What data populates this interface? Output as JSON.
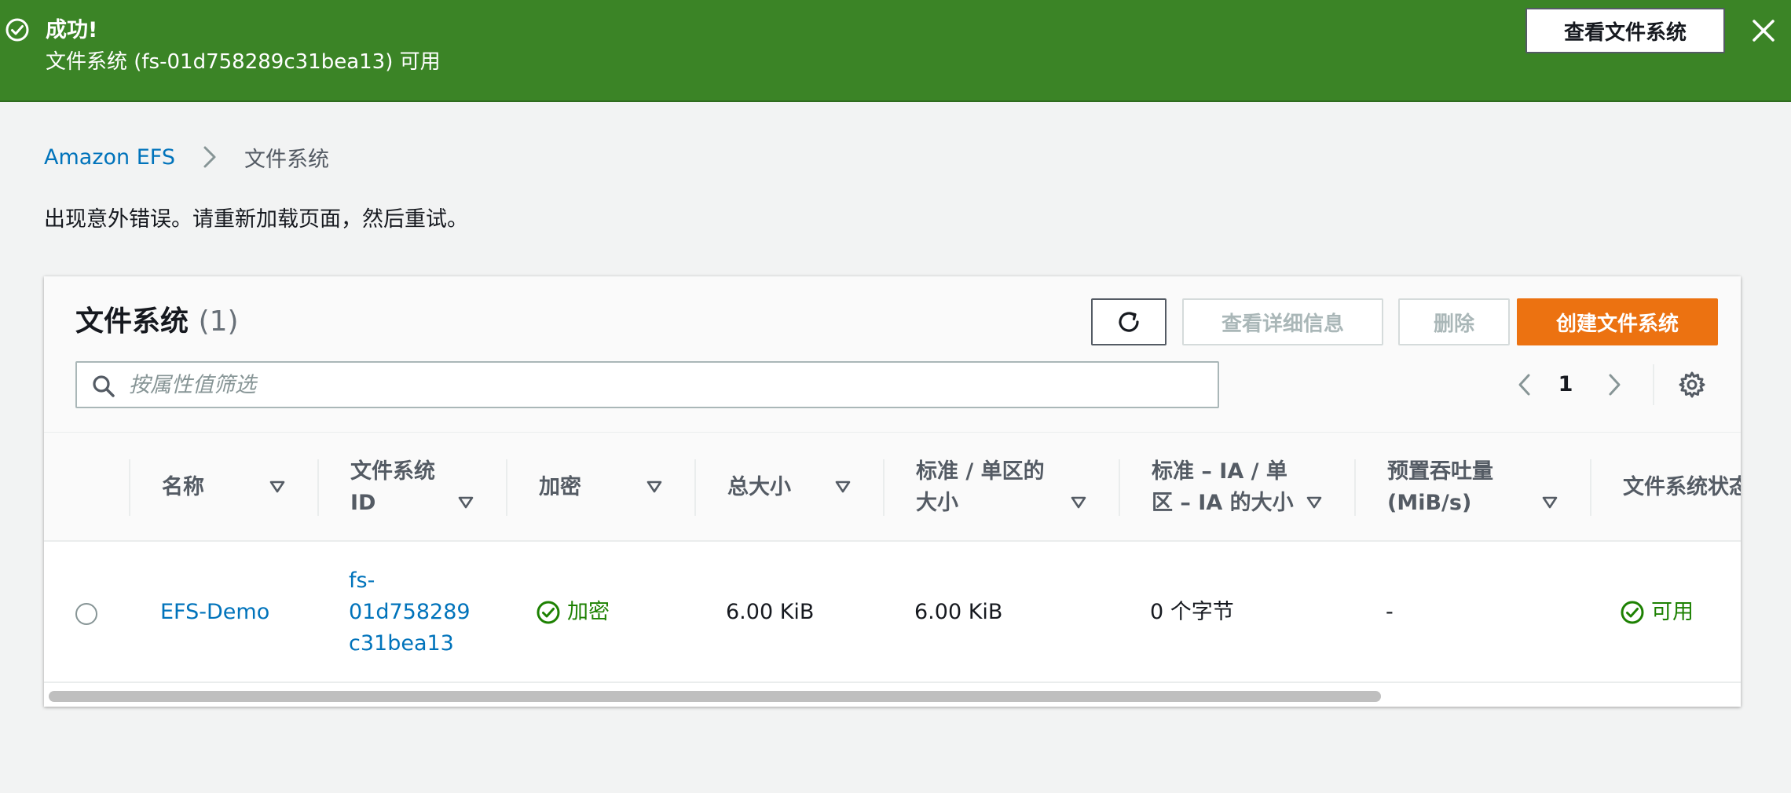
{
  "flash": {
    "title": "成功!",
    "message": "文件系统 (fs-01d758289c31bea13) 可用",
    "action_label": "查看文件系统"
  },
  "breadcrumb": {
    "root": "Amazon EFS",
    "current": "文件系统"
  },
  "error_message": "出现意外错误。请重新加载页面，然后重试。",
  "panel": {
    "title": "文件系统",
    "count": "(1)",
    "buttons": {
      "details": "查看详细信息",
      "delete": "删除",
      "create": "创建文件系统"
    },
    "search_placeholder": "按属性值筛选",
    "page_number": "1"
  },
  "table": {
    "columns": [
      {
        "line1": "名称",
        "line2": ""
      },
      {
        "line1": "文件系统",
        "line2": "ID"
      },
      {
        "line1": "加密",
        "line2": ""
      },
      {
        "line1": "总大小",
        "line2": ""
      },
      {
        "line1": "标准 / 单区的",
        "line2": "大小"
      },
      {
        "line1": "标准 – IA / 单",
        "line2": "区 – IA 的大小"
      },
      {
        "line1": "预置吞吐量",
        "line2": "(MiB/s)"
      },
      {
        "line1": "文件系统状态",
        "line2": ""
      }
    ],
    "rows": [
      {
        "name": "EFS-Demo",
        "id_lines": [
          "fs-",
          "01d758289",
          "c31bea13"
        ],
        "encrypted": "加密",
        "total_size": "6.00 KiB",
        "standard_size": "6.00 KiB",
        "ia_size": "0 个字节",
        "throughput": "-",
        "status": "可用"
      }
    ]
  },
  "colors": {
    "success_green": "#3b8426",
    "link_blue": "#0073bb",
    "primary_orange": "#ec7211",
    "status_green": "#1d8102"
  },
  "icons": {
    "flash": "check-circle-icon",
    "close": "close-icon",
    "breadcrumb_separator": "chevron-right-icon",
    "refresh": "refresh-icon",
    "search": "search-icon",
    "prev": "chevron-left-icon",
    "next": "chevron-right-icon",
    "settings": "gear-icon",
    "sort": "sort-caret-icon"
  }
}
